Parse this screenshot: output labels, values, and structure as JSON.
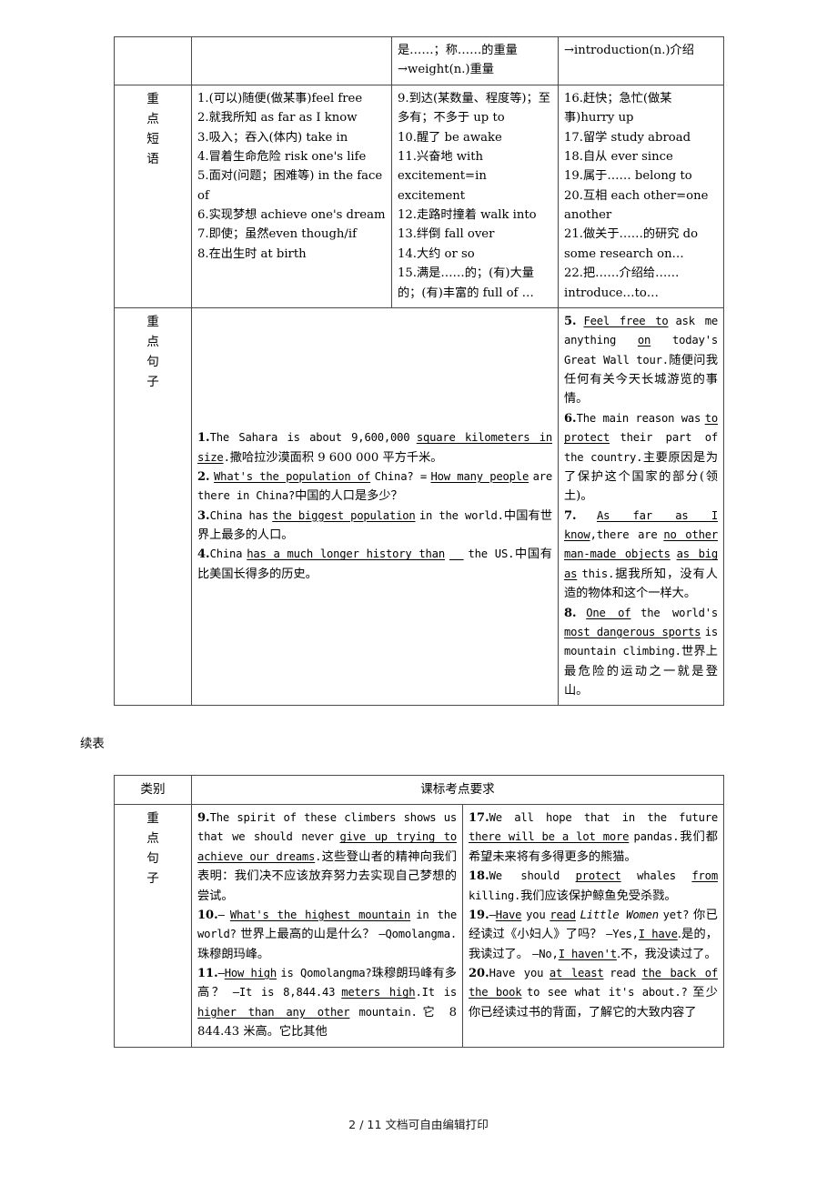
{
  "document": {
    "footer": "2 / 11 文档可自由编辑打印",
    "continued_caption": "续表"
  },
  "table_one": {
    "top_row": {
      "col3": "是……；称……的重量→weight(n.)重量",
      "col4": "→introduction(n.)介绍"
    },
    "phrases_row": {
      "label": "重点短语",
      "col2": [
        "1.(可以)随便(做某事)feel free",
        "2.就我所知 as far as I know",
        "3.吸入；吞入(体内) take in",
        "4.冒着生命危险 risk one's life",
        "5.面对(问题；困难等) in the face of",
        "6.实现梦想 achieve one's dream",
        "7.即使；虽然even though/if",
        "8.在出生时 at birth"
      ],
      "col3": [
        "9.到达(某数量、程度等)；至多有；不多于 up to",
        "10.醒了 be awake",
        "11.兴奋地 with excitement=in excitement",
        "12.走路时撞着 walk into",
        "13.绊倒 fall over",
        "14.大约 or so",
        "15.满是……的；(有)大量的；(有)丰富的 full of …"
      ],
      "col4": [
        "16.赶快；急忙(做某事)hurry up",
        "17.留学 study abroad",
        "18.自从 ever since",
        "19.属于…… belong to",
        "20.互相 each other=one another",
        "21.做关于……的研究 do some research on…",
        "22.把……介绍给……introduce…to…"
      ]
    },
    "sentences_row": {
      "label": "重点句子",
      "left_items": [
        {
          "num": "1.",
          "en_before": "The Sahara is about 9,600,000",
          "blank": "square kilometers in size",
          "en_after": ".",
          "cn": "撒哈拉沙漠面积 9 600 000 平方千米。"
        },
        {
          "num": "2.",
          "blank1": "What's the population of",
          "en_mid1": "China? =",
          "blank2": "How many people",
          "en_mid2": "are there in China?",
          "cn": "中国的人口是多少？"
        },
        {
          "num": "3.",
          "en_before": "China has",
          "blank": "the biggest population",
          "en_after": "in the world.",
          "cn": "中国有世界上最多的人口。"
        },
        {
          "num": "4.",
          "en_before": "China",
          "blank": "has a much longer history than",
          "en_after": "the US.",
          "cn": "中国有比美国长得多的历史。"
        }
      ],
      "right_items": [
        {
          "num": "5.",
          "blank1": "Feel free to",
          "en_mid1": "ask me anything",
          "blank2": "on",
          "en_mid2": "today's Great Wall tour.",
          "cn": "随便问我任何有关今天长城游览的事情。"
        },
        {
          "num": "6.",
          "en_before": "The main reason was",
          "blank": "to protect",
          "en_after": "their part of the country.",
          "cn": "主要原因是为了保护这个国家的部分(领土)。"
        },
        {
          "num": "7.",
          "blank1": "As far as I know",
          "en_mid1": ",there are",
          "blank2": "no other man-made objects",
          "blank3": "as big as",
          "en_mid2": "this.",
          "cn": "据我所知，没有人造的物体和这个一样大。"
        },
        {
          "num": "8.",
          "blank1": "One of",
          "en_mid1": "the world's",
          "blank2": "most dangerous sports",
          "en_mid2": "is mountain climbing.",
          "cn": "世界上最危险的运动之一就是登山。"
        }
      ]
    }
  },
  "table_two": {
    "header": {
      "col1": "类别",
      "col2": "课标考点要求"
    },
    "sentences_row": {
      "label": "重点句子",
      "left_items": [
        {
          "num": "9.",
          "en_before": "The spirit of these climbers shows us that we should never",
          "blank": "give up trying to achieve our dreams",
          "en_after": ".",
          "cn": "这些登山者的精神向我们表明：我们决不应该放弃努力去实现自己梦想的尝试。"
        },
        {
          "num": "10.",
          "dash": "—",
          "blank": "What's the highest mountain",
          "en_after": "in the world?",
          "cn": "世界上最高的山是什么？",
          "answer_en": "—Qomolangma.",
          "answer_cn": "珠穆朗玛峰。"
        },
        {
          "num": "11.",
          "dash": "—",
          "blank1": "How high",
          "en_mid1": "is Qomolangma?",
          "cn1": "珠穆朗玛峰有多高？",
          "answer_lead": "—It is 8,844.43",
          "blank2": "meters high",
          "en_mid2": ".It is",
          "blank3": "higher than any other",
          "en_mid3": "mountain.",
          "cn2": "它 8 844.43 米高。它比其他"
        }
      ],
      "right_items": [
        {
          "num": "17.",
          "en_before": "We all hope that in the future",
          "blank": "there will be a lot more",
          "en_after": "pandas.",
          "cn": "我们都希望未来将有多得更多的熊猫。"
        },
        {
          "num": "18.",
          "en_before": "We should",
          "blank1": "protect",
          "en_mid1": "whales",
          "blank2": "from",
          "en_after": "killing.",
          "cn": "我们应该保护鲸鱼免受杀戮。"
        },
        {
          "num": "19.",
          "dash": "—",
          "blank1": "Have",
          "en_mid1": "you",
          "blank2": "read",
          "title": "Little Women",
          "en_mid2": "yet?",
          "cn1": "你已经读过《小妇人》了吗？",
          "yes_lead": "—Yes,",
          "yes_blank": "I have",
          "yes_cn": ".是的，我读过了。",
          "no_lead": "—No,",
          "no_blank": "I haven't",
          "no_cn": ".不，我没读过了。"
        },
        {
          "num": "20.",
          "en_before": "Have you",
          "blank1": "at least",
          "en_mid1": "read",
          "blank2": "the back of the book",
          "en_mid2": "to see what it's about.?",
          "cn": "至少你已经读过书的背面，了解它的大致内容了"
        }
      ]
    }
  }
}
